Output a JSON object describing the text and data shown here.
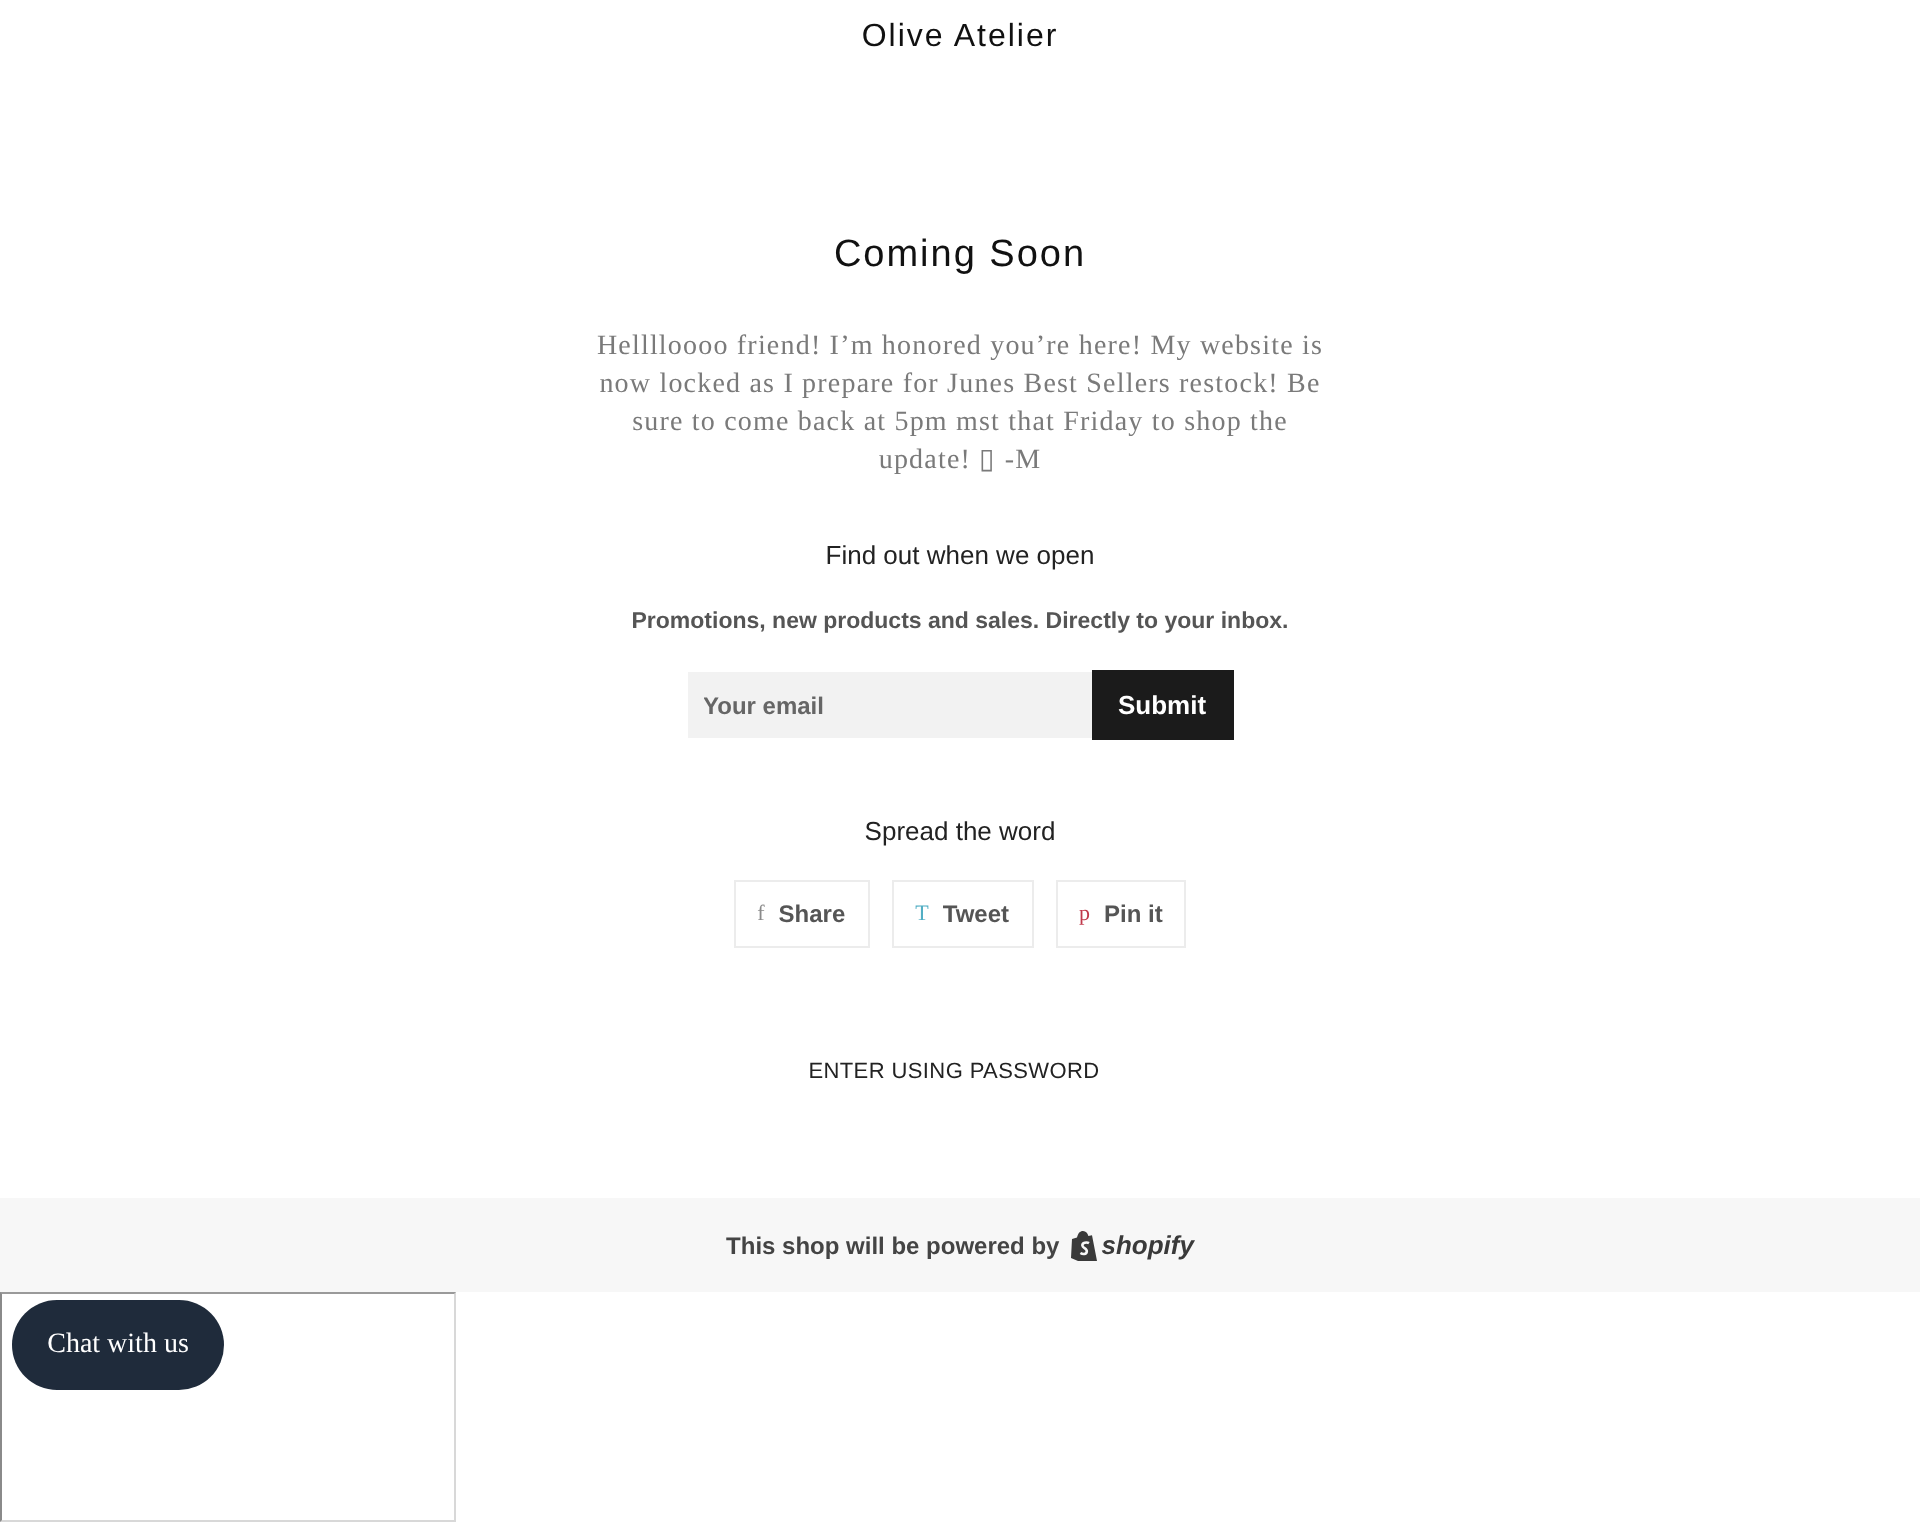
{
  "header": {
    "title": "Olive Atelier"
  },
  "hero": {
    "heading": "Coming Soon",
    "message": "Helllloooo friend! I’m honored you’re here! My website is now locked as I prepare for Junes Best Sellers restock! Be sure to come back at 5pm mst that Friday to shop the update! ▯ -M"
  },
  "signup": {
    "heading": "Find out when we open",
    "subheading": "Promotions, new products and sales. Directly to your inbox.",
    "email": {
      "placeholder": "Your email"
    },
    "submit": "Submit"
  },
  "share": {
    "heading": "Spread the word",
    "buttons": [
      {
        "glyph": "f",
        "label": "Share",
        "color": "#8a8a8a"
      },
      {
        "glyph": "T",
        "label": "Tweet",
        "color": "#52aec4"
      },
      {
        "glyph": "p",
        "label": "Pin it",
        "color": "#c0394b"
      }
    ]
  },
  "password_link": "ENTER USING PASSWORD",
  "footer": {
    "text": "This shop will be powered by",
    "brand": "shopify"
  },
  "chat": {
    "button": "Chat with us"
  }
}
